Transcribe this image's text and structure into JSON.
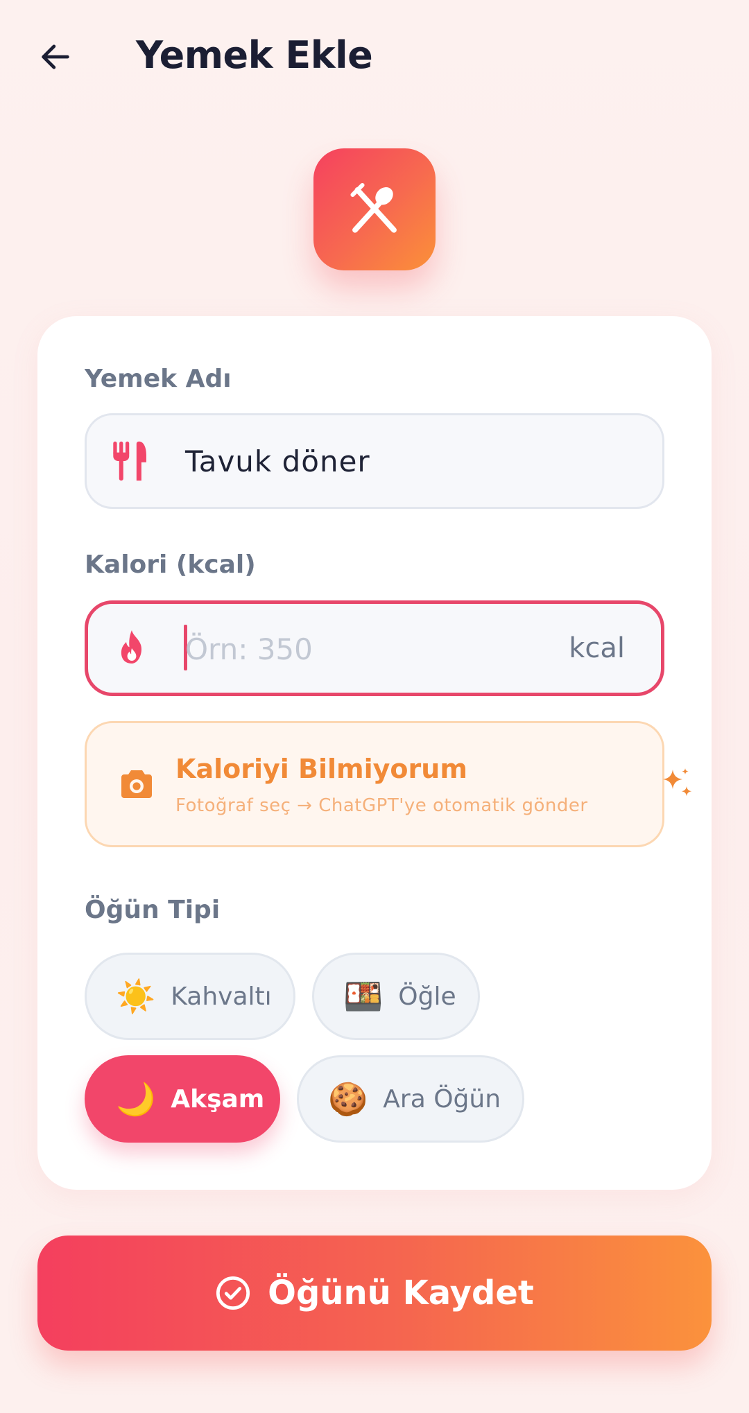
{
  "header": {
    "title": "Yemek Ekle",
    "back_icon": "arrow-left-icon"
  },
  "hero": {
    "icon": "fork-spoon-icon",
    "gradient": [
      "#f5415f",
      "#fb9138"
    ]
  },
  "form": {
    "food_name": {
      "label": "Yemek Adı",
      "value": "Tavuk döner",
      "icon": "fork-knife-icon"
    },
    "calories": {
      "label": "Kalori (kcal)",
      "value": "",
      "placeholder": "Örn: 350",
      "unit": "kcal",
      "icon": "flame-icon",
      "accent": "#e7476a"
    },
    "photo_helper": {
      "title": "Kaloriyi Bilmiyorum",
      "subtitle": "Fotoğraf seç → ChatGPT'ye otomatik gönder",
      "icon": "camera-icon",
      "accent": "#f18a37"
    },
    "meal_type": {
      "label": "Öğün Tipi",
      "selected": "Akşam",
      "options": [
        {
          "label": "Kahvaltı",
          "emoji": "☀️"
        },
        {
          "label": "Öğle",
          "emoji": "🍱"
        },
        {
          "label": "Akşam",
          "emoji": "🌙"
        },
        {
          "label": "Ara Öğün",
          "emoji": "🍪"
        }
      ]
    }
  },
  "actions": {
    "save_label": "Öğünü Kaydet",
    "save_icon": "check-circle-icon"
  }
}
